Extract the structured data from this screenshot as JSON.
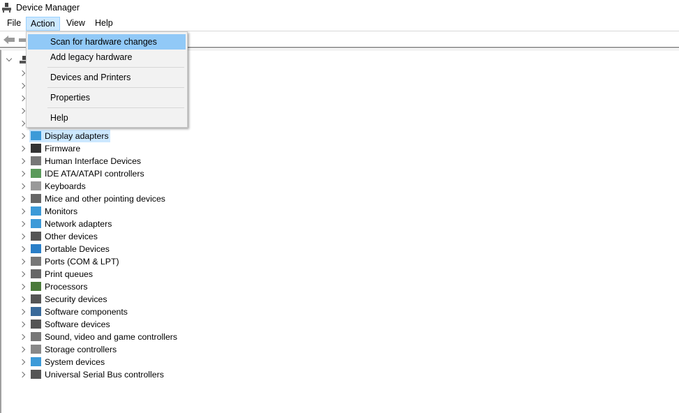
{
  "window": {
    "title": "Device Manager",
    "app_icon": "device-manager-icon"
  },
  "menubar": {
    "items": [
      {
        "label": "File"
      },
      {
        "label": "Action",
        "active": true
      },
      {
        "label": "View"
      },
      {
        "label": "Help"
      }
    ]
  },
  "toolbar": {
    "back_icon": "back-arrow-icon",
    "forward_icon": "forward-arrow-icon"
  },
  "action_menu": {
    "items": [
      {
        "label": "Scan for hardware changes",
        "highlighted": true
      },
      {
        "label": "Add legacy hardware"
      },
      {
        "separator": true
      },
      {
        "label": "Devices and Printers"
      },
      {
        "separator": true
      },
      {
        "label": "Properties"
      },
      {
        "separator": true
      },
      {
        "label": "Help"
      }
    ]
  },
  "tree": {
    "root": {
      "expanded": true,
      "icon": "computer-icon"
    },
    "categories": [
      {
        "label": "Display adapters",
        "icon": "display-adapter-icon",
        "selected": true
      },
      {
        "label": "Firmware",
        "icon": "chip-icon"
      },
      {
        "label": "Human Interface Devices",
        "icon": "hid-icon"
      },
      {
        "label": "IDE ATA/ATAPI controllers",
        "icon": "ide-controller-icon"
      },
      {
        "label": "Keyboards",
        "icon": "keyboard-icon"
      },
      {
        "label": "Mice and other pointing devices",
        "icon": "mouse-icon"
      },
      {
        "label": "Monitors",
        "icon": "monitor-icon"
      },
      {
        "label": "Network adapters",
        "icon": "network-adapter-icon"
      },
      {
        "label": "Other devices",
        "icon": "unknown-device-icon"
      },
      {
        "label": "Portable Devices",
        "icon": "portable-device-icon"
      },
      {
        "label": "Ports (COM & LPT)",
        "icon": "port-icon"
      },
      {
        "label": "Print queues",
        "icon": "printer-icon"
      },
      {
        "label": "Processors",
        "icon": "processor-icon"
      },
      {
        "label": "Security devices",
        "icon": "security-device-icon"
      },
      {
        "label": "Software components",
        "icon": "software-component-icon"
      },
      {
        "label": "Software devices",
        "icon": "software-device-icon"
      },
      {
        "label": "Sound, video and game controllers",
        "icon": "speaker-icon"
      },
      {
        "label": "Storage controllers",
        "icon": "storage-controller-icon"
      },
      {
        "label": "System devices",
        "icon": "system-device-icon"
      },
      {
        "label": "Universal Serial Bus controllers",
        "icon": "usb-icon"
      }
    ]
  },
  "colors": {
    "selection": "#cce8ff",
    "menu_highlight": "#91c9f7",
    "menu_bg": "#f2f2f2"
  }
}
